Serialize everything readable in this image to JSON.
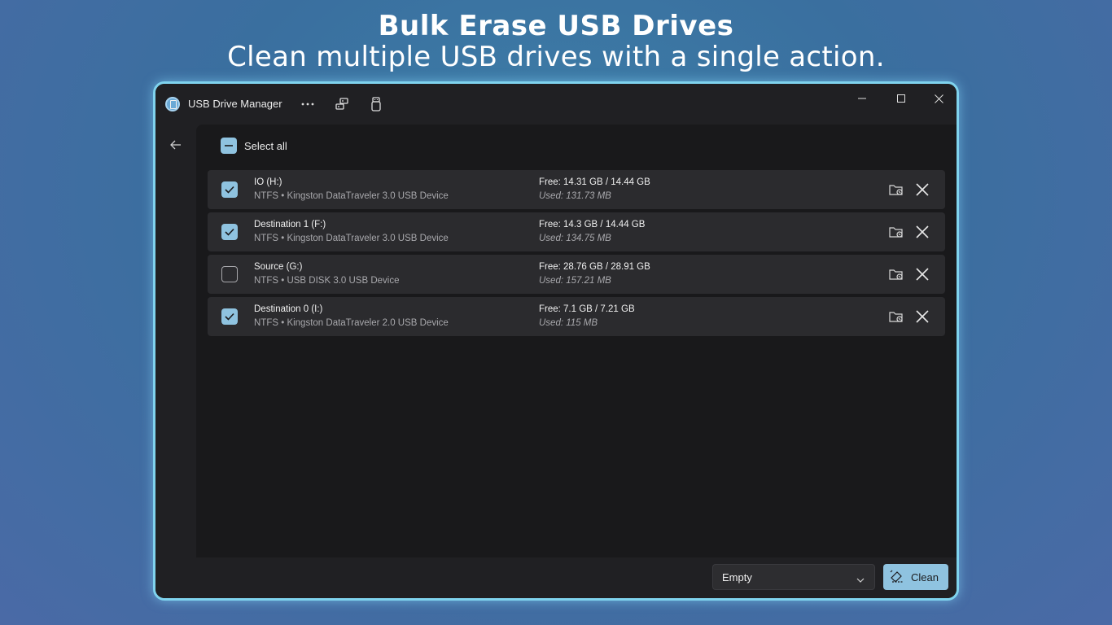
{
  "hero": {
    "title": "Bulk Erase USB Drives",
    "subtitle": "Clean multiple USB drives with a single action."
  },
  "window": {
    "title": "USB Drive Manager",
    "icons": [
      "usb-app-icon",
      "more-icon",
      "drives-icon",
      "eject-icon",
      "minimize-icon",
      "maximize-icon",
      "close-icon"
    ]
  },
  "select_all": {
    "label": "Select all",
    "state": "indeterminate"
  },
  "drives": [
    {
      "name": "IO (H:)",
      "desc": "NTFS • Kingston DataTraveler 3.0 USB Device",
      "free": "Free: 14.31 GB / 14.44 GB",
      "used": "Used: 131.73 MB",
      "checked": true
    },
    {
      "name": "Destination 1 (F:)",
      "desc": "NTFS • Kingston DataTraveler 3.0 USB Device",
      "free": "Free: 14.3 GB / 14.44 GB",
      "used": "Used: 134.75 MB",
      "checked": true
    },
    {
      "name": "Source (G:)",
      "desc": "NTFS • USB DISK 3.0 USB Device",
      "free": "Free: 28.76 GB / 28.91 GB",
      "used": "Used: 157.21 MB",
      "checked": false
    },
    {
      "name": "Destination 0 (I:)",
      "desc": "NTFS • Kingston DataTraveler 2.0 USB Device",
      "free": "Free: 7.1 GB / 7.21 GB",
      "used": "Used: 115 MB",
      "checked": true
    }
  ],
  "bottom": {
    "mode_selected": "Empty",
    "clean_label": "Clean"
  },
  "colors": {
    "accent": "#8fc3e0",
    "frame_glow": "#7fd3ee"
  }
}
